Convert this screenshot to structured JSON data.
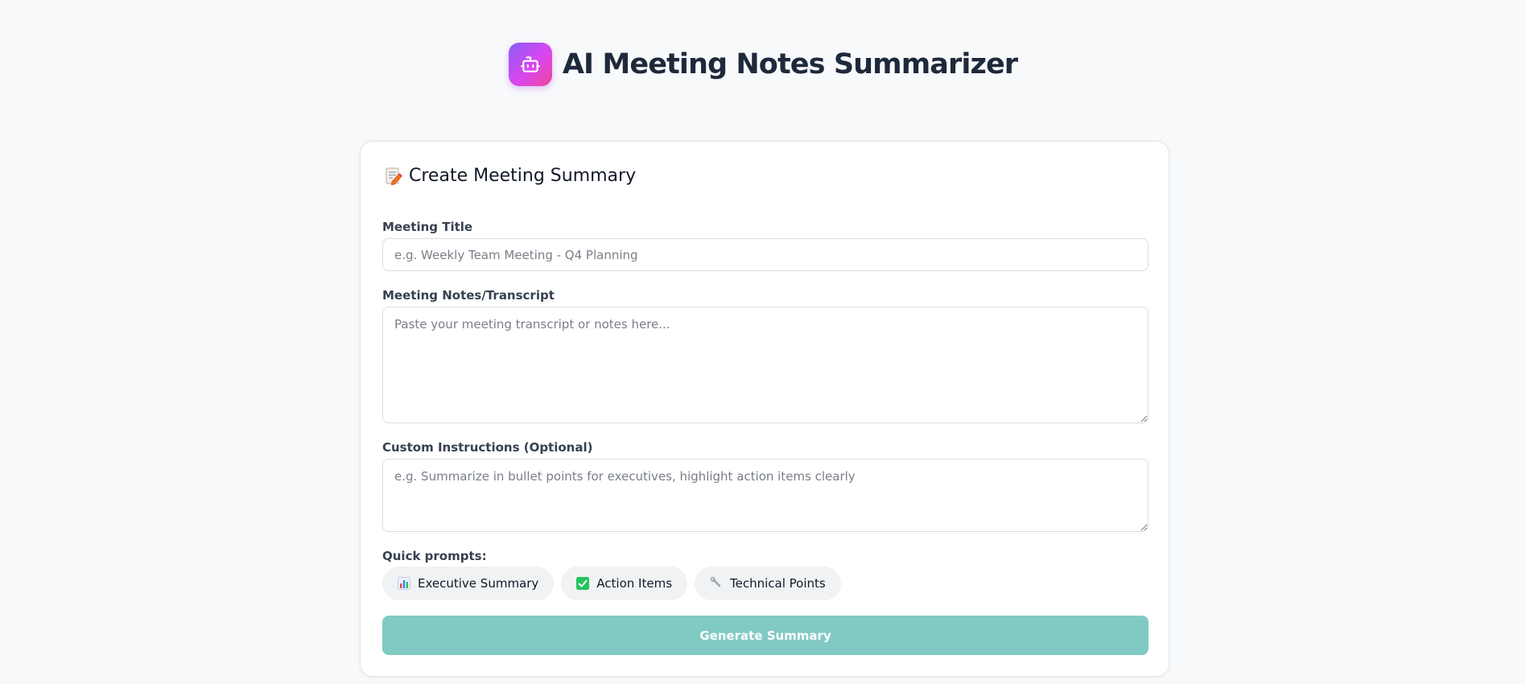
{
  "header": {
    "title": "AI Meeting Notes Summarizer",
    "logo_icon": "robot-icon",
    "logo_gradient": [
      "#8b5cf6",
      "#ec4899"
    ]
  },
  "card": {
    "title": "Create Meeting Summary",
    "title_icon": "memo-icon"
  },
  "form": {
    "meeting_title": {
      "label": "Meeting Title",
      "value": "",
      "placeholder": "e.g. Weekly Team Meeting - Q4 Planning"
    },
    "notes": {
      "label": "Meeting Notes/Transcript",
      "value": "",
      "placeholder": "Paste your meeting transcript or notes here..."
    },
    "instructions": {
      "label": "Custom Instructions (Optional)",
      "value": "",
      "placeholder": "e.g. Summarize in bullet points for executives, highlight action items clearly"
    }
  },
  "quick_prompts": {
    "label": "Quick prompts:",
    "items": [
      {
        "label": "Executive Summary",
        "icon": "bar-chart-icon"
      },
      {
        "label": "Action Items",
        "icon": "checkmark-icon"
      },
      {
        "label": "Technical Points",
        "icon": "wrench-icon"
      }
    ]
  },
  "generate_button": {
    "label": "Generate Summary",
    "color": "#80cac3"
  }
}
